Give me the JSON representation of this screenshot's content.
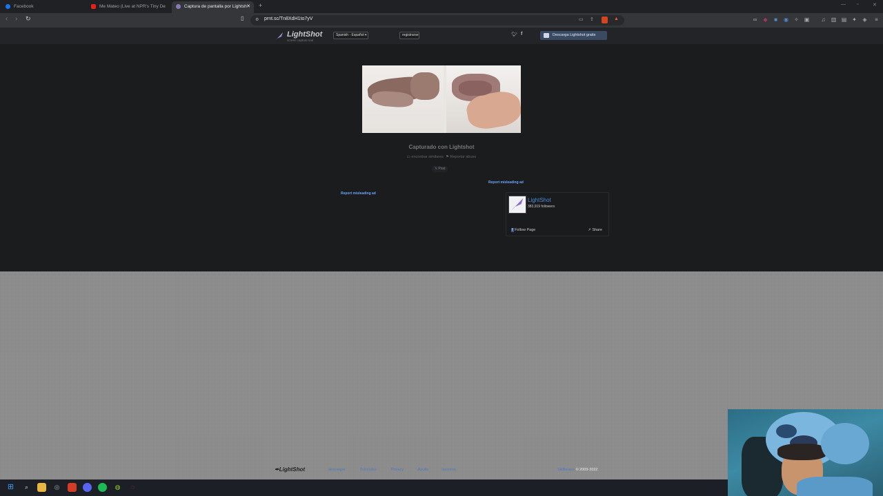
{
  "browser": {
    "tabs": [
      {
        "label": "Facebook",
        "icon": "facebook-icon",
        "active": false
      },
      {
        "label": "Me Mateo (Live at NPR's Tiny De",
        "icon": "youtube-icon",
        "active": false
      },
      {
        "label": "Captura de pantalla por Lightsh",
        "icon": "lightshot-icon",
        "active": true
      }
    ],
    "new_tab": "+",
    "url": "prnt.sc/Tn8XdH1to7yV"
  },
  "header": {
    "logo_text": "LightShot",
    "logo_sub": "screen capture tool",
    "language": "Spanish - Español",
    "register": "registrarse",
    "download": "Descarga Lightshot gratis"
  },
  "main": {
    "caption": "Capturado con Lightshot",
    "find_similar": "encontrar similares",
    "report_abuse": "Reportar abuso",
    "post": "Post",
    "mislead_1": "Report misleading ad",
    "mislead_2": "Report misleading ad"
  },
  "facebook_widget": {
    "name": "LightShot",
    "followers": "383,919 followers",
    "follow": "Follow Page",
    "share": "Share"
  },
  "footer": {
    "logo": "LightShot",
    "links": [
      "descargar",
      "Tutoriales",
      "Privacy",
      "¡Ayuda",
      "tassorus"
    ],
    "brand": "Skillbrains",
    "copyright": " © 2009-2022"
  }
}
